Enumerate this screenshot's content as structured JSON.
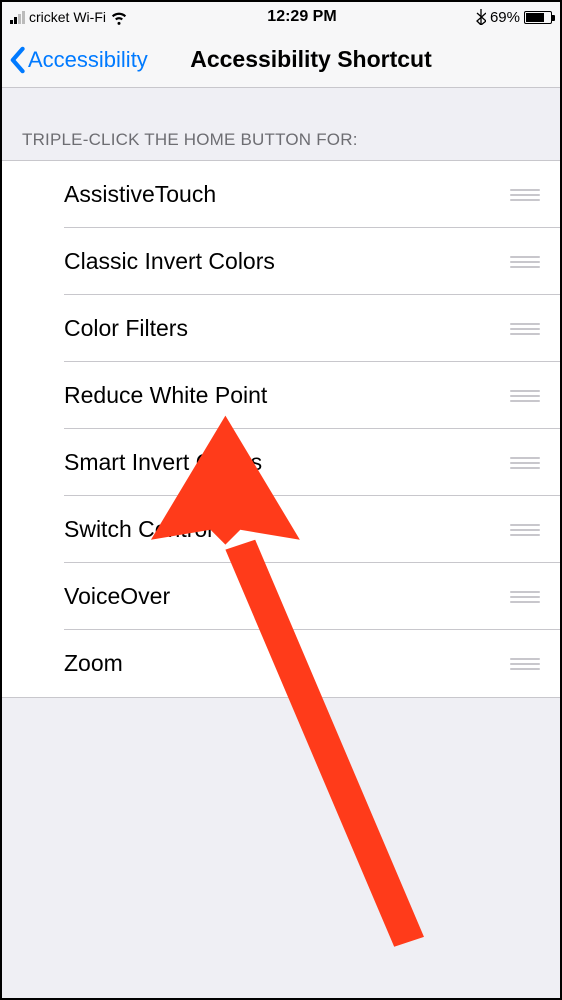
{
  "status": {
    "carrier": "cricket Wi-Fi",
    "time": "12:29 PM",
    "battery_pct": "69%",
    "battery_level": 0.69
  },
  "nav": {
    "back_label": "Accessibility",
    "title": "Accessibility Shortcut"
  },
  "section_header": "TRIPLE-CLICK THE HOME BUTTON FOR:",
  "items": [
    {
      "label": "AssistiveTouch"
    },
    {
      "label": "Classic Invert Colors"
    },
    {
      "label": "Color Filters"
    },
    {
      "label": "Reduce White Point"
    },
    {
      "label": "Smart Invert Colors"
    },
    {
      "label": "Switch Control"
    },
    {
      "label": "VoiceOver"
    },
    {
      "label": "Zoom"
    }
  ],
  "annotation": {
    "arrow_color": "#ff3b1a",
    "points_to_item_index": 3
  }
}
